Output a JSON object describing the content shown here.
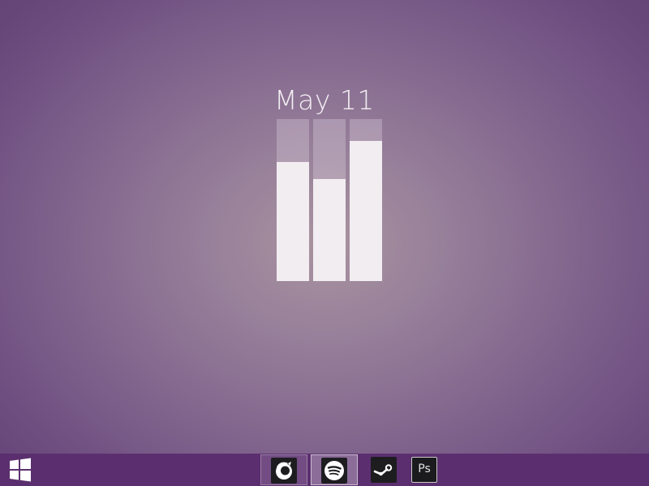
{
  "date": {
    "label": "May 11"
  },
  "usage_widget": {
    "bars": [
      {
        "name": "bar-1",
        "level_percent": 73.5
      },
      {
        "name": "bar-2",
        "level_percent": 63
      },
      {
        "name": "bar-3",
        "level_percent": 86.5
      }
    ],
    "fill_color": "#f1edf1",
    "track_color": "rgba(240,230,240,0.28)"
  },
  "taskbar": {
    "color": "#5b2f6f",
    "start": {
      "icon": "windows-logo-icon"
    },
    "apps": [
      {
        "name": "firefox",
        "icon": "firefox-icon",
        "state": "running"
      },
      {
        "name": "spotify",
        "icon": "spotify-icon",
        "state": "active"
      },
      {
        "name": "steam",
        "icon": "steam-icon",
        "state": "pinned"
      },
      {
        "name": "photoshop",
        "icon": "photoshop-icon",
        "state": "pinned",
        "label": "Ps"
      }
    ]
  }
}
